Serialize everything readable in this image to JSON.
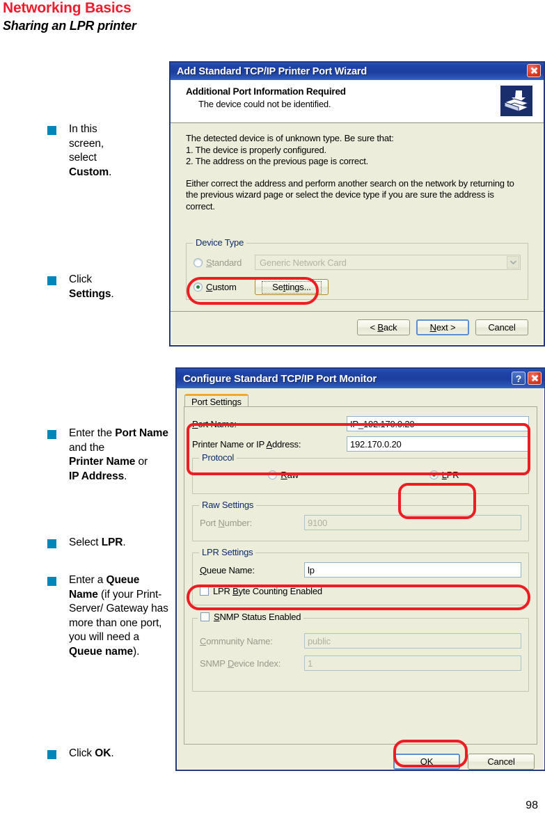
{
  "header": {
    "title": "Networking Basics",
    "subtitle": "Sharing an LPR printer"
  },
  "page_number": "98",
  "instructions": [
    {
      "id": "bullet-select-custom",
      "html": "In this screen, select <b>Custom</b>."
    },
    {
      "id": "bullet-click-settings",
      "html": "Click <b>Settings</b>."
    },
    {
      "id": "bullet-enter-port-name",
      "html": "Enter the <b>Port Name</b> and the <b>Printer&nbsp;Name</b> or<br><b>IP Address</b>."
    },
    {
      "id": "bullet-select-lpr",
      "html": "Select <b>LPR</b>."
    },
    {
      "id": "bullet-enter-queue-name",
      "html": "Enter a <b>Queue Name</b> (if your Print-Server/ Gateway has more than one port, you will need a <b>Queue name</b>)."
    },
    {
      "id": "bullet-click-ok",
      "html": "Click <b>OK</b>."
    }
  ],
  "wizard": {
    "title": "Add Standard TCP/IP Printer Port Wizard",
    "close_label": "close-button",
    "heading": "Additional Port Information Required",
    "subheading": "The device could not be identified.",
    "body_line_1": "The detected device is of unknown type.  Be sure that:",
    "body_line_2": "1. The device is properly configured.",
    "body_line_3": "2.  The address on the previous page is correct.",
    "body_para_2": "Either correct the address and perform another search on the network by returning to the previous wizard page or select the device type if you are sure the address is correct.",
    "device_type": {
      "legend": "Device Type",
      "standard_label": "Standard",
      "standard_accel": "S",
      "standard_selected": false,
      "standard_combo_value": "Generic Network Card",
      "custom_label": "Custom",
      "custom_accel": "C",
      "custom_selected": true,
      "settings_label": "Settings...",
      "settings_accel": "t"
    },
    "buttons": {
      "back": "< Back",
      "back_accel": "B",
      "next": "Next >",
      "next_accel": "N",
      "cancel": "Cancel"
    }
  },
  "monitor": {
    "title": "Configure Standard TCP/IP Port Monitor",
    "help_label": "?",
    "tab": "Port Settings",
    "port_name_label": "Port Name:",
    "port_name_accel": "P",
    "port_name_value": "IP_192.170.0.20",
    "printer_name_label": "Printer Name or IP Address:",
    "printer_name_accel": "A",
    "printer_name_value": "192.170.0.20",
    "protocol": {
      "legend": "Protocol",
      "raw_label": "Raw",
      "raw_accel": "R",
      "raw_selected": false,
      "lpr_label": "LPR",
      "lpr_accel": "L",
      "lpr_selected": true
    },
    "raw_settings": {
      "legend": "Raw Settings",
      "port_number_label": "Port Number:",
      "port_number_accel": "N",
      "port_number_value": "9100",
      "disabled": true
    },
    "lpr_settings": {
      "legend": "LPR Settings",
      "queue_name_label": "Queue Name:",
      "queue_name_accel": "Q",
      "queue_name_value": "lp",
      "byte_counting_label": "LPR Byte Counting Enabled",
      "byte_counting_accel": "B",
      "byte_counting_checked": false
    },
    "snmp": {
      "legend": "SNMP Status Enabled",
      "legend_accel": "S",
      "checked": false,
      "community_label": "Community Name:",
      "community_accel": "C",
      "community_value": "public",
      "device_index_label": "SNMP Device Index:",
      "device_index_accel": "D",
      "device_index_value": "1"
    },
    "buttons": {
      "ok": "OK",
      "cancel": "Cancel"
    }
  },
  "colors": {
    "brand_red": "#ed1c2e",
    "bullet_teal": "#0086b8",
    "dialog_face": "#eceedb",
    "title_blue": "#1e44a8",
    "highlight_ring": "#ee1d23"
  }
}
